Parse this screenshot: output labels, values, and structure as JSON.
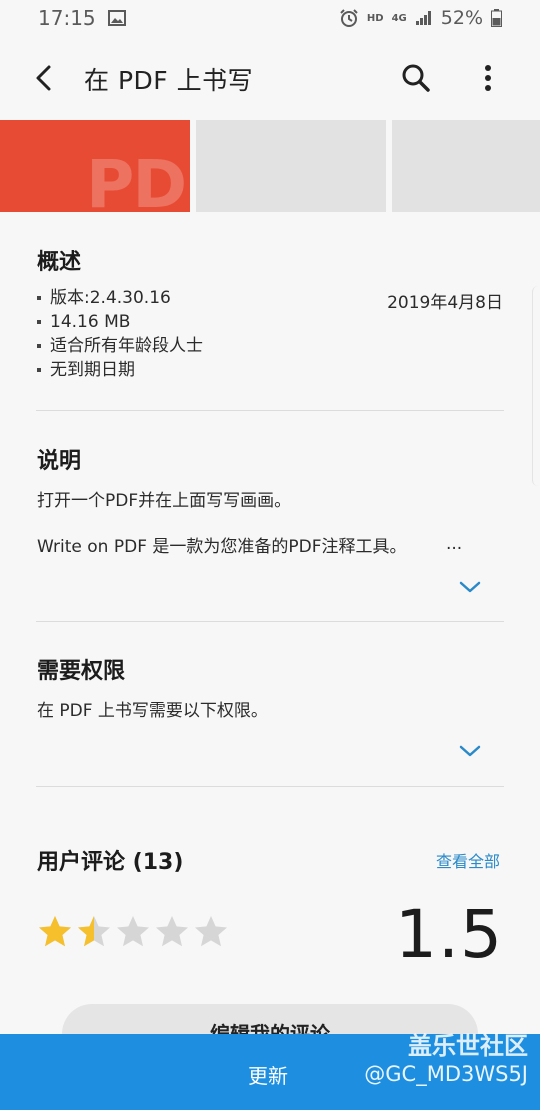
{
  "status_bar": {
    "time": "17:15",
    "battery": "52%",
    "hd": "HD",
    "network": "4G"
  },
  "app_bar": {
    "title": "在 PDF 上书写"
  },
  "screenshots": {
    "preview_text": "PD"
  },
  "overview": {
    "title": "概述",
    "items": [
      "版本:2.4.30.16",
      "14.16 MB",
      "适合所有年龄段人士",
      "无到期日期"
    ],
    "date": "2019年4月8日"
  },
  "description": {
    "title": "说明",
    "line1": "打开一个PDF并在上面写写画画。",
    "line2": "Write on PDF 是一款为您准备的PDF注释工具。",
    "ellipsis": "..."
  },
  "permissions": {
    "title": "需要权限",
    "text": "在 PDF 上书写需要以下权限。"
  },
  "reviews": {
    "title": "用户评论 (13)",
    "see_all": "查看全部",
    "rating": "1.5",
    "stars_value": 1.5,
    "stars_max": 5,
    "edit_button": "编辑我的评论"
  },
  "bottom_bar": {
    "update_label": "更新",
    "watermark_line1": "盖乐世社区",
    "watermark_line2": "@GC_MD3WS5J"
  },
  "colors": {
    "accent": "#2a89c9",
    "update_bar": "#1e8fe0",
    "star_filled": "#f5c02c",
    "star_empty": "#d6d6d6",
    "shot_red": "#e84b34"
  },
  "icons": [
    "image-icon",
    "alarm-icon",
    "signal-icon",
    "battery-icon",
    "back-arrow-icon",
    "search-icon",
    "more-vert-icon",
    "chevron-down-icon",
    "star-icon"
  ]
}
